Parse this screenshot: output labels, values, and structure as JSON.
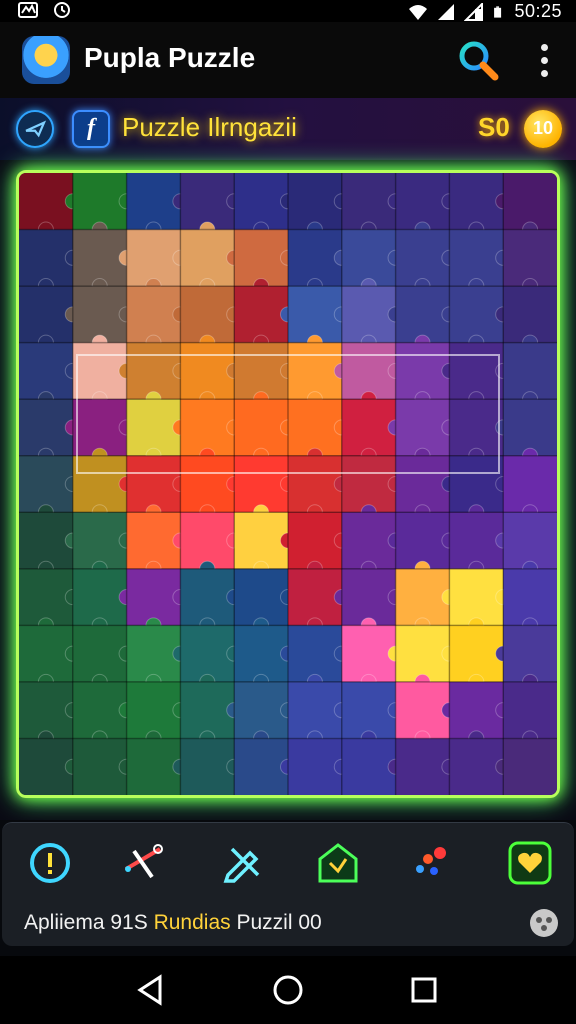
{
  "status_bar": {
    "time": "50:25",
    "icons": [
      "notification-icon",
      "alarm-icon",
      "wifi-icon",
      "signal-icon",
      "signal-icon",
      "battery-icon"
    ]
  },
  "app_bar": {
    "title": "Pupla Puzzle",
    "icons": [
      "app-logo-icon",
      "search-icon",
      "more-vertical-icon"
    ]
  },
  "toolbar": {
    "title": "Puzzle Ilrngazii",
    "score": "S0",
    "coin_label": "10",
    "icons": [
      "share-icon",
      "facebook-icon",
      "coin-icon"
    ]
  },
  "board": {
    "columns": 10,
    "rows": 11
  },
  "bottom_bar": {
    "status_text_a": "Apliiema 91S ",
    "status_text_b": "Rundias",
    "status_text_c": " Puzzil 00",
    "icons": [
      "info-icon",
      "tools-icon",
      "edit-icon",
      "home-icon",
      "palette-icon",
      "heart-icon",
      "settings-badge-icon"
    ]
  },
  "nav_bar": {
    "icons": [
      "back-icon",
      "home-circle-icon",
      "recents-icon"
    ]
  },
  "colors": {
    "board_border": "#b8ff5c",
    "toolbar_title": "#ffe23a",
    "score": "#ffd52a",
    "highlight_text": "#ffd23a"
  }
}
